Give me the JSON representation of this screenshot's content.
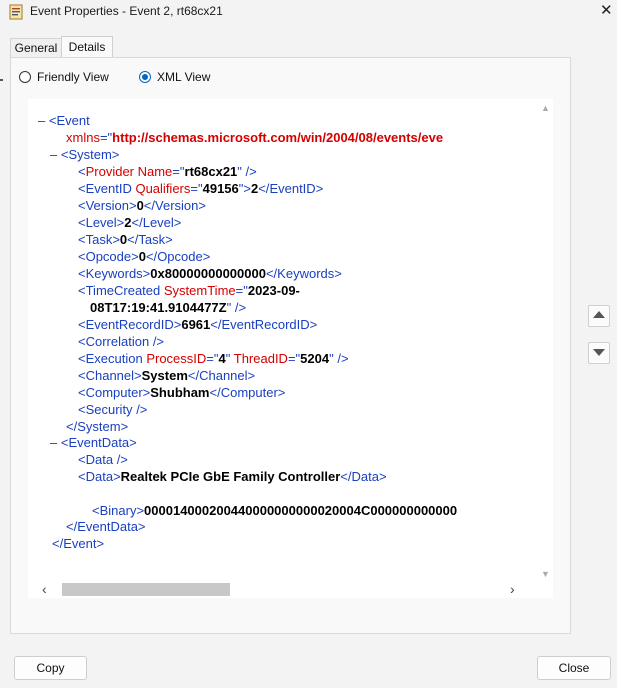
{
  "window": {
    "title": "Event Properties - Event 2, rt68cx21",
    "close_glyph": "✕"
  },
  "tabs": [
    {
      "label": "General"
    },
    {
      "label": "Details"
    }
  ],
  "view_options": {
    "friendly": {
      "label": "Friendly View",
      "selected": false
    },
    "xml": {
      "label": "XML View",
      "selected": true
    }
  },
  "xml": {
    "event_tag": "Event",
    "xmlns_attr": "xmlns",
    "xmlns_value": "http://schemas.microsoft.com/win/2004/08/events/eve",
    "system_tag": "System",
    "provider_attr": "Provider Name",
    "provider_name": "rt68cx21",
    "eventid_tag": "EventID",
    "eventid_attr": "Qualifiers",
    "qualifiers": "49156",
    "event_id": "2",
    "version_tag": "Version",
    "version": "0",
    "level_tag": "Level",
    "level": "2",
    "task_tag": "Task",
    "task": "0",
    "opcode_tag": "Opcode",
    "opcode": "0",
    "keywords_tag": "Keywords",
    "keywords": "0x80000000000000",
    "timecreated_tag": "TimeCreated",
    "timecreated_attr": "SystemTime",
    "system_time_part1": "2023-09-",
    "system_time_part2": "08T17:19:41.9104477Z",
    "eventrecordid_tag": "EventRecordID",
    "event_record_id": "6961",
    "correlation_tag": "Correlation",
    "execution_tag": "Execution",
    "process_attr": "ProcessID",
    "process_id": "4",
    "thread_attr": "ThreadID",
    "thread_id": "5204",
    "channel_tag": "Channel",
    "channel": "System",
    "computer_tag": "Computer",
    "computer": "Shubham",
    "security_tag": "Security",
    "eventdata_tag": "EventData",
    "data_tag": "Data",
    "data_value": "Realtek PCIe GbE Family Controller",
    "binary_tag": "Binary",
    "binary_value": "000014000200440000000000020004C000000000000"
  },
  "buttons": {
    "copy": "Copy",
    "close": "Close"
  },
  "colors": {
    "markup": "#d40000",
    "tag": "#1a3fbf",
    "accent": "#0067c0"
  }
}
